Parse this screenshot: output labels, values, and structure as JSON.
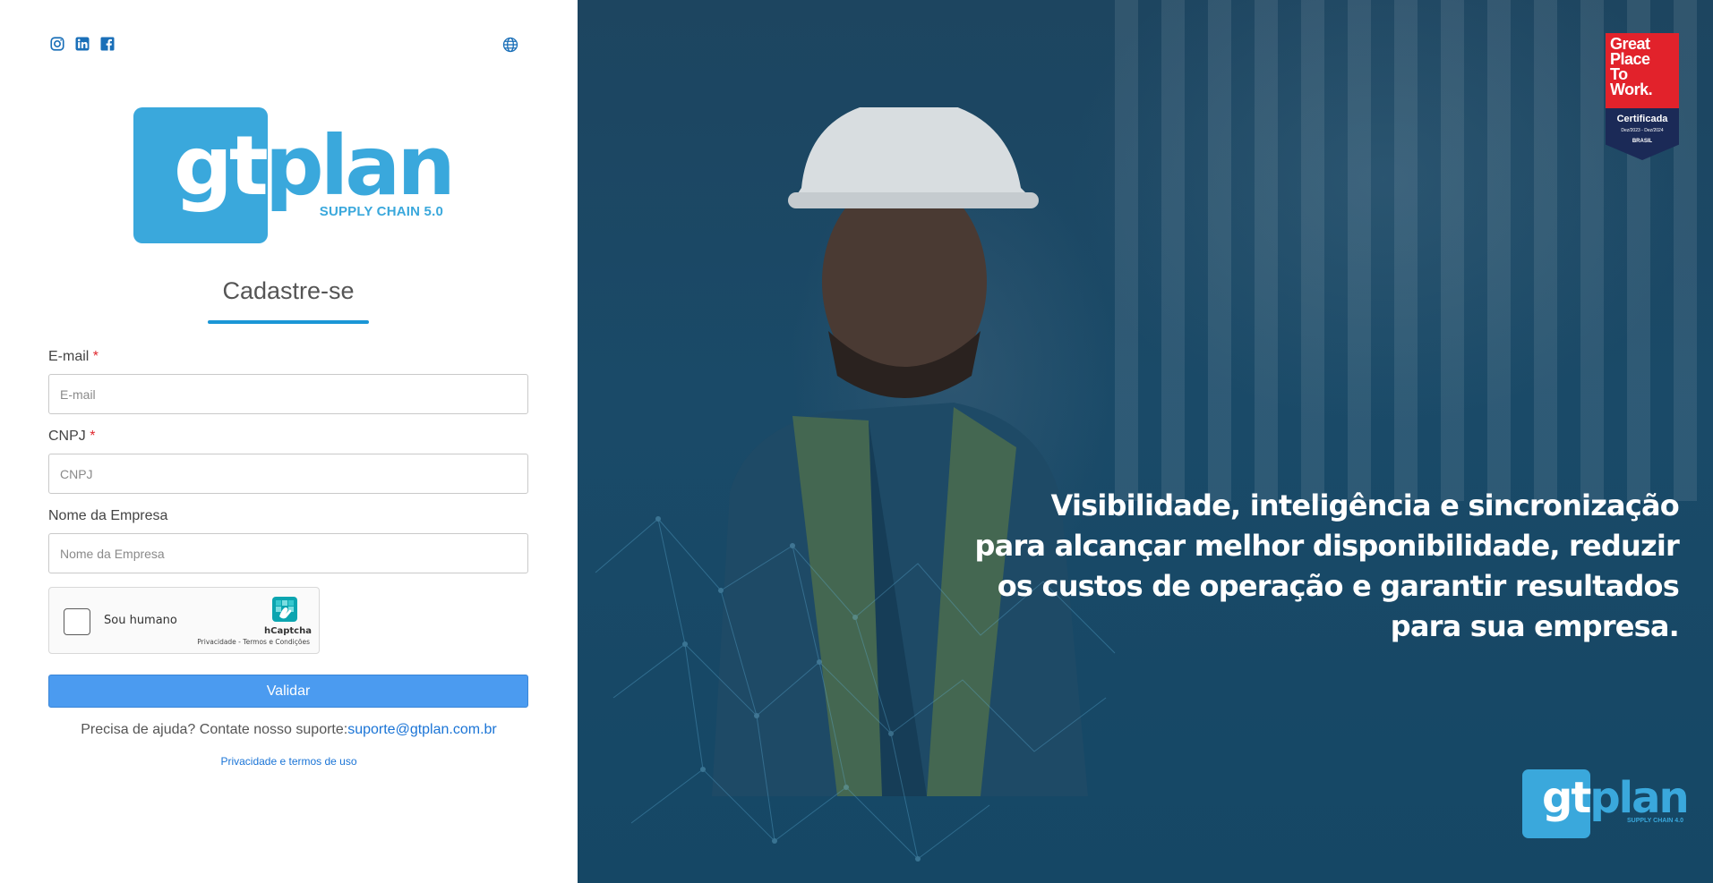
{
  "social": {
    "icons": [
      "instagram-icon",
      "linkedin-icon",
      "facebook-icon"
    ],
    "language_icon": "globe-icon"
  },
  "logo": {
    "gt": "gt",
    "plan": "plan",
    "subtitle": "SUPPLY CHAIN 5.0",
    "brand_color": "#3aa8dc"
  },
  "form": {
    "tab_label": "Cadastre-se",
    "email": {
      "label": "E-mail",
      "required_mark": "*",
      "placeholder": "E-mail",
      "value": ""
    },
    "cnpj": {
      "label": "CNPJ",
      "required_mark": "*",
      "placeholder": "CNPJ",
      "value": ""
    },
    "company": {
      "label": "Nome da Empresa",
      "placeholder": "Nome da Empresa",
      "value": ""
    },
    "captcha": {
      "label": "Sou humano",
      "provider": "hCaptcha",
      "terms": "Privacidade - Termos e Condições"
    },
    "submit_label": "Validar",
    "submit_color": "#4b9bf0",
    "help_text": "Precisa de ajuda? Contate nosso suporte:",
    "help_email": "suporte@gtplan.com.br",
    "privacy_link": "Privacidade e termos de uso"
  },
  "hero": {
    "badge": {
      "line1": "Great",
      "line2": "Place",
      "line3": "To",
      "line4": "Work.",
      "certified": "Certificada",
      "dates": "Dez/2023 - Dez/2024",
      "country": "BRASIL"
    },
    "tagline_lines": [
      "Visibilidade, inteligência e sincronização",
      "para alcançar melhor disponibilidade, reduzir",
      "os custos de operação e garantir resultados",
      "para sua empresa."
    ],
    "logo_small": {
      "gt": "gt",
      "plan": "plan",
      "subtitle": "SUPPLY CHAIN 4.0"
    }
  }
}
